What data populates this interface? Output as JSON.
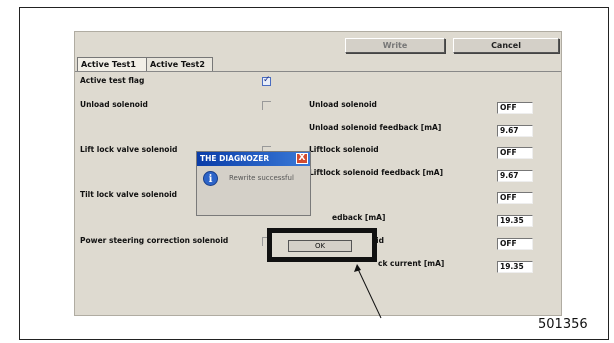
{
  "toolbar": {
    "write_label": "Write",
    "cancel_label": "Cancel"
  },
  "tabs": [
    {
      "label": "Active Test1"
    },
    {
      "label": "Active Test2"
    }
  ],
  "left_rows": [
    {
      "label": "Active test flag",
      "checked": true
    },
    {
      "label": "Unload solenoid",
      "checked": false
    },
    {
      "label": "Lift lock valve solenoid",
      "checked": false
    },
    {
      "label": "Tilt lock valve solenoid",
      "checked": false
    },
    {
      "label": "Power steering correction solenoid",
      "checked": false
    }
  ],
  "right_rows": [
    {
      "label": "Unload solenoid",
      "value": "OFF"
    },
    {
      "label": "Unload solenoid feedback [mA]",
      "value": "9.67"
    },
    {
      "label": "Liftlock solenoid",
      "value": "OFF"
    },
    {
      "label": "Liftlock solenoid feedback [mA]",
      "value": "9.67"
    },
    {
      "label": "",
      "value": "OFF"
    },
    {
      "label": "edback [mA]",
      "value": "19.35"
    },
    {
      "label": "id",
      "value": "OFF"
    },
    {
      "label": "ck current [mA]",
      "value": "19.35"
    }
  ],
  "dialog": {
    "title": "THE DIAGNOZER",
    "message": "Rewrite successful",
    "ok_label": "OK",
    "close_glyph": "X",
    "info_glyph": "i"
  },
  "figure_code": "501356",
  "colors": {
    "title_bar": "#0a3ca8",
    "close_button": "#d24b30",
    "window_bg": "#dedad0"
  }
}
